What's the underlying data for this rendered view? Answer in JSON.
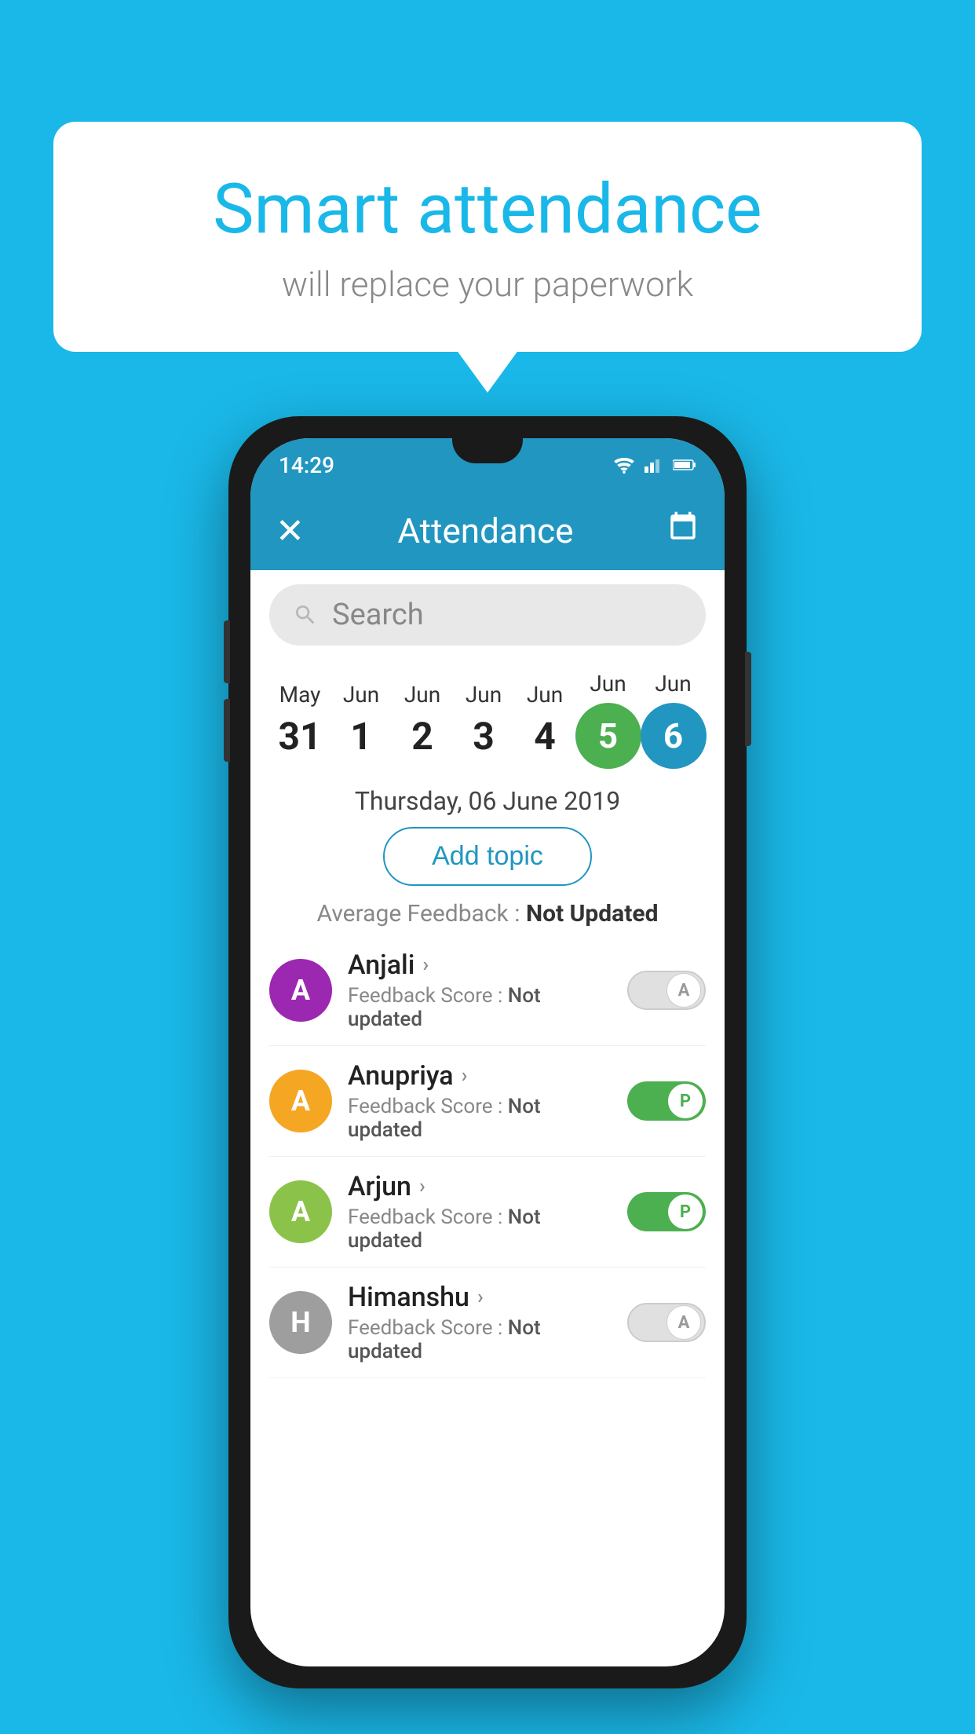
{
  "background_color": "#1ab8e8",
  "bubble": {
    "title": "Smart attendance",
    "subtitle": "will replace your paperwork"
  },
  "phone": {
    "status_bar": {
      "time": "14:29",
      "icons": [
        "wifi",
        "signal",
        "battery"
      ]
    },
    "app_bar": {
      "close_label": "✕",
      "title": "Attendance",
      "calendar_icon": "📅"
    },
    "search": {
      "placeholder": "Search"
    },
    "calendar": {
      "days": [
        {
          "month": "May",
          "date": "31",
          "style": "normal"
        },
        {
          "month": "Jun",
          "date": "1",
          "style": "normal"
        },
        {
          "month": "Jun",
          "date": "2",
          "style": "normal"
        },
        {
          "month": "Jun",
          "date": "3",
          "style": "normal"
        },
        {
          "month": "Jun",
          "date": "4",
          "style": "normal"
        },
        {
          "month": "Jun",
          "date": "5",
          "style": "today"
        },
        {
          "month": "Jun",
          "date": "6",
          "style": "selected"
        }
      ]
    },
    "selected_date": "Thursday, 06 June 2019",
    "add_topic_label": "Add topic",
    "avg_feedback_label": "Average Feedback :",
    "avg_feedback_value": "Not Updated",
    "students": [
      {
        "name": "Anjali",
        "avatar_letter": "A",
        "avatar_color": "#9c27b0",
        "feedback_label": "Feedback Score :",
        "feedback_value": "Not updated",
        "toggle_state": "off",
        "toggle_letter": "A"
      },
      {
        "name": "Anupriya",
        "avatar_letter": "A",
        "avatar_color": "#f5a623",
        "feedback_label": "Feedback Score :",
        "feedback_value": "Not updated",
        "toggle_state": "on",
        "toggle_letter": "P"
      },
      {
        "name": "Arjun",
        "avatar_letter": "A",
        "avatar_color": "#8bc34a",
        "feedback_label": "Feedback Score :",
        "feedback_value": "Not updated",
        "toggle_state": "on",
        "toggle_letter": "P"
      },
      {
        "name": "Himanshu",
        "avatar_letter": "H",
        "avatar_color": "#9e9e9e",
        "feedback_label": "Feedback Score :",
        "feedback_value": "Not updated",
        "toggle_state": "off",
        "toggle_letter": "A"
      }
    ]
  }
}
